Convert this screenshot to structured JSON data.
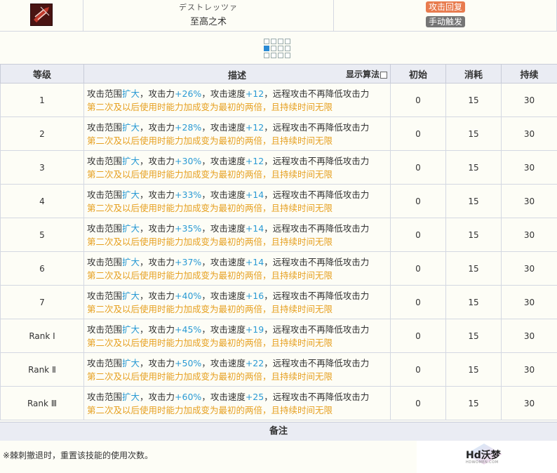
{
  "skill": {
    "jp_name": "デストレッツァ",
    "cn_name": "至高之术",
    "icon": "skill-icon",
    "tag_recover": "攻击回复",
    "tag_trigger": "手动触发",
    "tag_recover_color": "#e87b4e",
    "tag_trigger_color": "#757575"
  },
  "level_grid": {
    "selected_index": 4,
    "total": 12
  },
  "table": {
    "headers": {
      "level": "等级",
      "desc": "描述",
      "algo": "显示算法",
      "init": "初始",
      "cost": "消耗",
      "duration": "持续"
    },
    "desc_text": {
      "p1": "攻击范围",
      "expand": "扩大",
      "p2": "，攻击力",
      "p3": "，攻击速度",
      "p4": "，远程攻击不再降低攻击力",
      "line2": "第二次及以后使用时能力加成变为最初的两倍，且持续时间无限"
    },
    "rows": [
      {
        "level": "1",
        "atk": "+26%",
        "spd": "+12",
        "init": "0",
        "cost": "15",
        "duration": "30"
      },
      {
        "level": "2",
        "atk": "+28%",
        "spd": "+12",
        "init": "0",
        "cost": "15",
        "duration": "30"
      },
      {
        "level": "3",
        "atk": "+30%",
        "spd": "+12",
        "init": "0",
        "cost": "15",
        "duration": "30"
      },
      {
        "level": "4",
        "atk": "+33%",
        "spd": "+14",
        "init": "0",
        "cost": "15",
        "duration": "30"
      },
      {
        "level": "5",
        "atk": "+35%",
        "spd": "+14",
        "init": "0",
        "cost": "15",
        "duration": "30"
      },
      {
        "level": "6",
        "atk": "+37%",
        "spd": "+14",
        "init": "0",
        "cost": "15",
        "duration": "30"
      },
      {
        "level": "7",
        "atk": "+40%",
        "spd": "+16",
        "init": "0",
        "cost": "15",
        "duration": "30"
      },
      {
        "level": "Rank Ⅰ",
        "atk": "+45%",
        "spd": "+19",
        "init": "0",
        "cost": "15",
        "duration": "30"
      },
      {
        "level": "Rank Ⅱ",
        "atk": "+50%",
        "spd": "+22",
        "init": "0",
        "cost": "15",
        "duration": "30"
      },
      {
        "level": "Rank Ⅲ",
        "atk": "+60%",
        "spd": "+25",
        "init": "0",
        "cost": "15",
        "duration": "30"
      }
    ]
  },
  "remarks": {
    "title": "备注",
    "text": "※棘刺撤退时，重置该技能的使用次数。"
  },
  "watermark": {
    "text": "Hd沃梦",
    "sub": "HDWOMEN.COM"
  }
}
